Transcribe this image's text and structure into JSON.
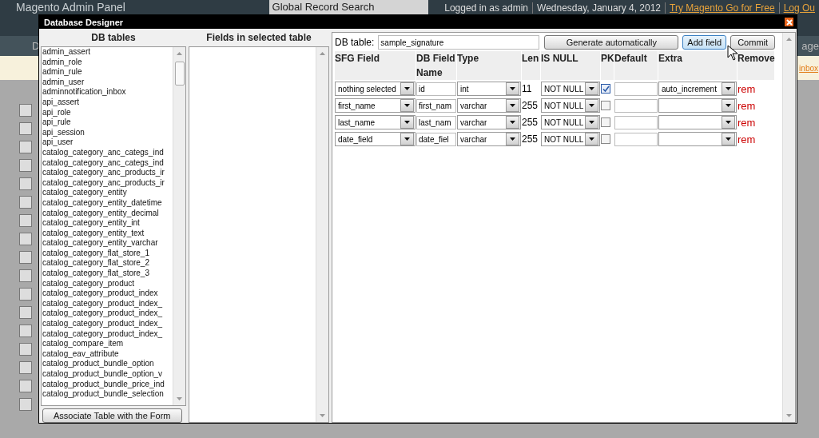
{
  "header": {
    "logo": "Magento Admin Panel",
    "search": "Global Record Search",
    "user_info": [
      {
        "text": "Logged in as admin",
        "kind": "plain"
      },
      {
        "text": "Wednesday, January 4, 2012",
        "kind": "plain"
      },
      {
        "text": "Try Magento Go for Free",
        "kind": "link"
      },
      {
        "text": "Log Ou",
        "kind": "link"
      }
    ]
  },
  "nav": {
    "left": "D",
    "right": "age"
  },
  "notice": {
    "right": "inbox"
  },
  "dialog": {
    "title": "Database Designer",
    "db_tables": {
      "heading": "DB tables",
      "items": [
        "admin_assert",
        "admin_role",
        "admin_rule",
        "admin_user",
        "adminnotification_inbox",
        "api_assert",
        "api_role",
        "api_rule",
        "api_session",
        "api_user",
        "catalog_category_anc_categs_ind",
        "catalog_category_anc_categs_ind",
        "catalog_category_anc_products_ir",
        "catalog_category_anc_products_ir",
        "catalog_category_entity",
        "catalog_category_entity_datetime",
        "catalog_category_entity_decimal",
        "catalog_category_entity_int",
        "catalog_category_entity_text",
        "catalog_category_entity_varchar",
        "catalog_category_flat_store_1",
        "catalog_category_flat_store_2",
        "catalog_category_flat_store_3",
        "catalog_category_product",
        "catalog_category_product_index",
        "catalog_category_product_index_",
        "catalog_category_product_index_",
        "catalog_category_product_index_",
        "catalog_category_product_index_",
        "catalog_compare_item",
        "catalog_eav_attribute",
        "catalog_product_bundle_option",
        "catalog_product_bundle_option_v",
        "catalog_product_bundle_price_ind",
        "catalog_product_bundle_selection"
      ],
      "button": "Associate Table with the Form"
    },
    "fields_panel": {
      "heading": "Fields in selected table"
    },
    "designer": {
      "table_label": "DB table:",
      "table_value": "sample_signature",
      "buttons": [
        "Generate automatically",
        "Add field",
        "Commit"
      ],
      "columns": [
        "SFG Field",
        "DB Field Name",
        "Type",
        "Len",
        "IS NULL",
        "PK",
        "Default",
        "Extra",
        "Remove"
      ],
      "rows": [
        {
          "sfg_field": "nothing selected",
          "db_field_name": "id",
          "type": "int",
          "len": "11",
          "is_null": "NOT NULL",
          "pk": true,
          "extra": "auto_increment",
          "remove": "rem"
        },
        {
          "sfg_field": "first_name",
          "db_field_name": "first_nam",
          "type": "varchar",
          "len": "255",
          "is_null": "NOT NULL",
          "pk": false,
          "remove": "rem"
        },
        {
          "sfg_field": "last_name",
          "db_field_name": "last_nam",
          "type": "varchar",
          "len": "255",
          "is_null": "NOT NULL",
          "pk": false,
          "remove": "rem"
        },
        {
          "sfg_field": "date_field",
          "db_field_name": "date_fiel",
          "type": "varchar",
          "len": "255",
          "is_null": "NOT NULL",
          "pk": false,
          "remove": "rem"
        }
      ]
    }
  }
}
